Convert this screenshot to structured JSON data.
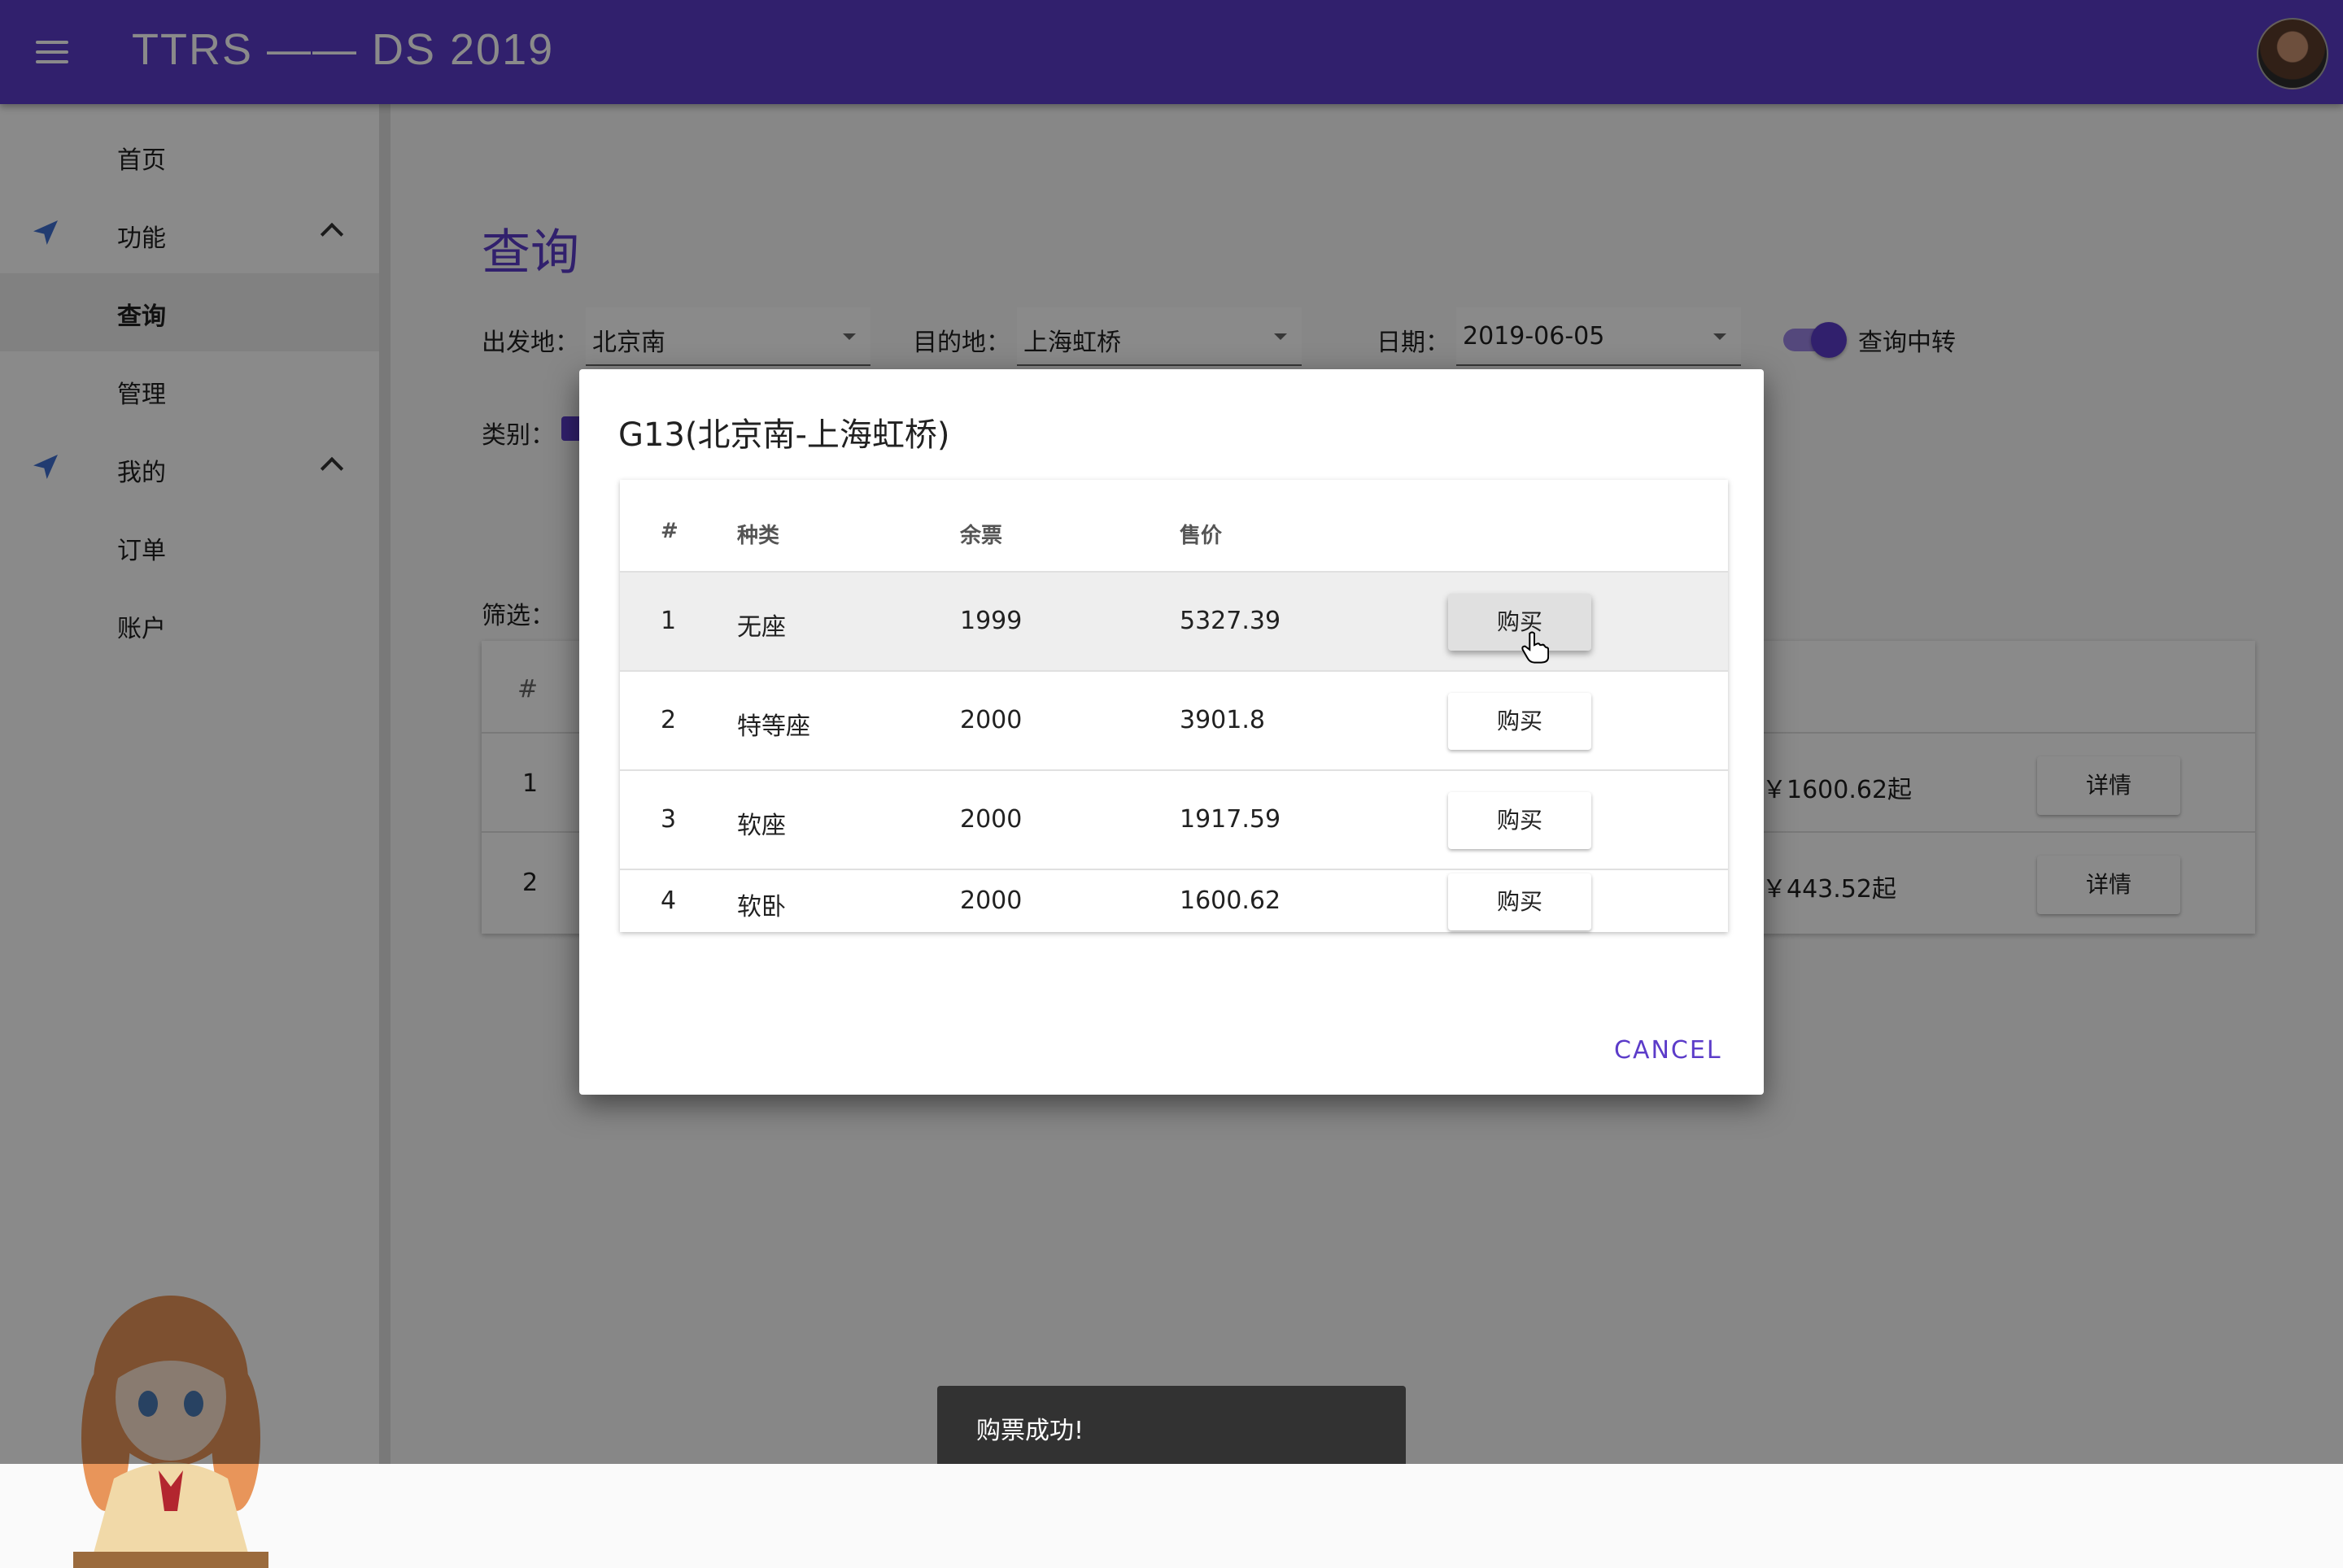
{
  "app": {
    "title": "TTRS —— DS 2019"
  },
  "sidebar": {
    "items": [
      {
        "label": "首页"
      },
      {
        "label": "功能"
      },
      {
        "label": "查询"
      },
      {
        "label": "管理"
      },
      {
        "label": "我的"
      },
      {
        "label": "订单"
      },
      {
        "label": "账户"
      }
    ]
  },
  "page": {
    "title": "查询",
    "from_label": "出发地：",
    "from_value": "北京南",
    "to_label": "目的地：",
    "to_value": "上海虹桥",
    "date_label": "日期：",
    "date_value": "2019-06-05",
    "transfer_label": "查询中转",
    "category_label": "类别：",
    "filter_label": "筛选：",
    "results": {
      "header_index": "#",
      "rows": [
        {
          "index": "1",
          "price": "￥1600.62起",
          "action": "详情"
        },
        {
          "index": "2",
          "price": "￥443.52起",
          "action": "详情"
        }
      ]
    }
  },
  "dialog": {
    "title": "G13(北京南-上海虹桥)",
    "headers": {
      "index": "#",
      "type": "种类",
      "remaining": "余票",
      "price": "售价"
    },
    "rows": [
      {
        "index": "1",
        "type": "无座",
        "remaining": "1999",
        "price": "5327.39",
        "action": "购买"
      },
      {
        "index": "2",
        "type": "特等座",
        "remaining": "2000",
        "price": "3901.8",
        "action": "购买"
      },
      {
        "index": "3",
        "type": "软座",
        "remaining": "2000",
        "price": "1917.59",
        "action": "购买"
      },
      {
        "index": "4",
        "type": "软卧",
        "remaining": "2000",
        "price": "1600.62",
        "action": "购买"
      }
    ],
    "cancel_label": "CANCEL"
  },
  "snackbar": {
    "message": "购票成功!"
  },
  "colors": {
    "primary": "#5c3cc9",
    "appbar": "#5c3cc9",
    "snackbar": "#323232"
  }
}
